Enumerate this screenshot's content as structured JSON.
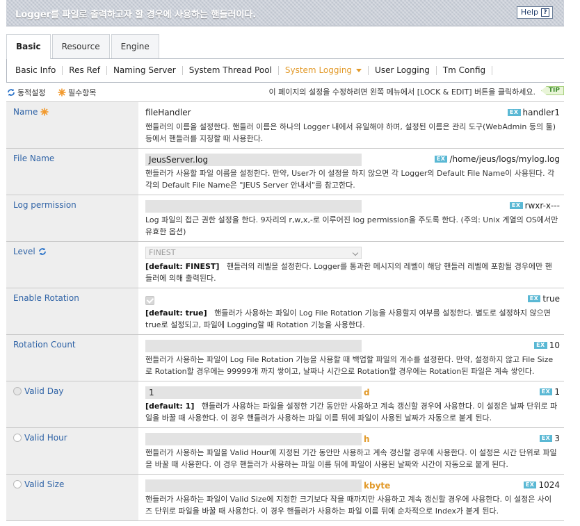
{
  "header": {
    "title": "Logger를 파일로 출력하고자 할 경우에 사용하는 핸들러이다.",
    "help_label": "Help",
    "help_icon": "?"
  },
  "main_tabs": [
    {
      "label": "Basic",
      "active": true
    },
    {
      "label": "Resource",
      "active": false
    },
    {
      "label": "Engine",
      "active": false
    }
  ],
  "sub_tabs": [
    {
      "label": "Basic Info"
    },
    {
      "label": "Res Ref"
    },
    {
      "label": "Naming Server"
    },
    {
      "label": "System Thread Pool"
    },
    {
      "label": "System Logging"
    },
    {
      "label": "User Logging"
    },
    {
      "label": "Tm Config"
    }
  ],
  "legend": {
    "dynamic_label": "동적설정",
    "required_label": "필수항목",
    "notice": "이 페이지의 설정을 수정하려면 왼쪽 메뉴에서 [LOCK & EDIT] 버튼을 클릭하세요.",
    "tip_label": "TIP"
  },
  "ex_badge": "EX",
  "colors": {
    "accent": "#e29a2a",
    "label_blue": "#2f63a6",
    "ex_badge": "#5ab8d4"
  },
  "fields": {
    "name": {
      "label": "Name",
      "value": "fileHandler",
      "example": "handler1",
      "desc": "핸들러의 이름을 설정한다. 핸들러 이름은 하나의 Logger 내에서 유일해야 하며, 설정된 이름은 관리 도구(WebAdmin 등의 툴) 등에서 핸들러를 지칭할 때 사용한다."
    },
    "file_name": {
      "label": "File Name",
      "value": "JeusServer.log",
      "example": "/home/jeus/logs/mylog.log",
      "desc": "핸들러가 사용할 파일 이름을 설정한다. 만약, User가 이 설정을 하지 않으면 각 Logger의 Default File Name이 사용된다. 각각의 Default File Name은 \"JEUS Server 안내서\"를 참고한다."
    },
    "log_permission": {
      "label": "Log permission",
      "value": "",
      "example": "rwxr-x---",
      "desc": "Log 파일의 접근 권한 설정을 한다. 9자리의 r,w,x,-로 이루어진 log permission을 주도록 한다. (주의: Unix 계열의 OS에서만 유효한 옵션)"
    },
    "level": {
      "label": "Level",
      "value": "FINEST",
      "default": "[default: FINEST]",
      "desc": "핸들러의 레벨을 설정한다. Logger를 통과한 메시지의 레벨이 해당 핸들러 레벨에 포함될 경우에만 핸들러에 의해 출력된다."
    },
    "enable_rotation": {
      "label": "Enable Rotation",
      "checked": true,
      "example": "true",
      "default": "[default: true]",
      "desc": "핸들러가 사용하는 파일이 Log File Rotation 기능을 사용할지 여부를 설정한다. 별도로 설정하지 않으면 true로 설정되고, 파일에 Logging할 때 Rotation 기능을 사용한다."
    },
    "rotation_count": {
      "label": "Rotation Count",
      "value": "",
      "example": "10",
      "desc": "핸들러가 사용하는 파일이 Log File Rotation 기능을 사용할 때 백업할 파일의 개수를 설정한다. 만약, 설정하지 않고 File Size로 Rotation할 경우에는 99999개 까지 쌓이고, 날짜나 시간으로 Rotation할 경우에는 Rotation된 파일은 계속 쌓인다."
    },
    "valid_day": {
      "label": "Valid Day",
      "value": "1",
      "unit": "d",
      "example": "1",
      "default": "[default: 1]",
      "desc": "핸들러가 사용하는 파일을 설정한 기간 동안만 사용하고 계속 갱신할 경우에 사용한다. 이 설정은 날짜 단위로 파일을 바꿀 때 사용한다. 이 경우 핸들러가 사용하는 파일 이름 뒤에 파일이 사용된 날짜가 자동으로 붙게 된다."
    },
    "valid_hour": {
      "label": "Valid Hour",
      "value": "",
      "unit": "h",
      "example": "3",
      "desc": "핸들러가 사용하는 파일을 Valid Hour에 지정된 기간 동안만 사용하고 계속 갱신할 경우에 사용한다. 이 설정은 시간 단위로 파일을 바꿀 때 사용한다. 이 경우 핸들러가 사용하는 파일 이름 뒤에 파일이 사용된 날짜와 시간이 자동으로 붙게 된다."
    },
    "valid_size": {
      "label": "Valid Size",
      "value": "",
      "unit": "kbyte",
      "example": "1024",
      "desc": "핸들러가 사용하는 파일이 Valid Size에 지정한 크기보다 작을 때까지만 사용하고 계속 갱신할 경우에 사용한다. 이 설정은 사이즈 단위로 파일을 바꿀 때 사용한다. 이 경우 핸들러가 사용하는 파일 이름 뒤에 순차적으로 Index가 붙게 된다."
    }
  }
}
